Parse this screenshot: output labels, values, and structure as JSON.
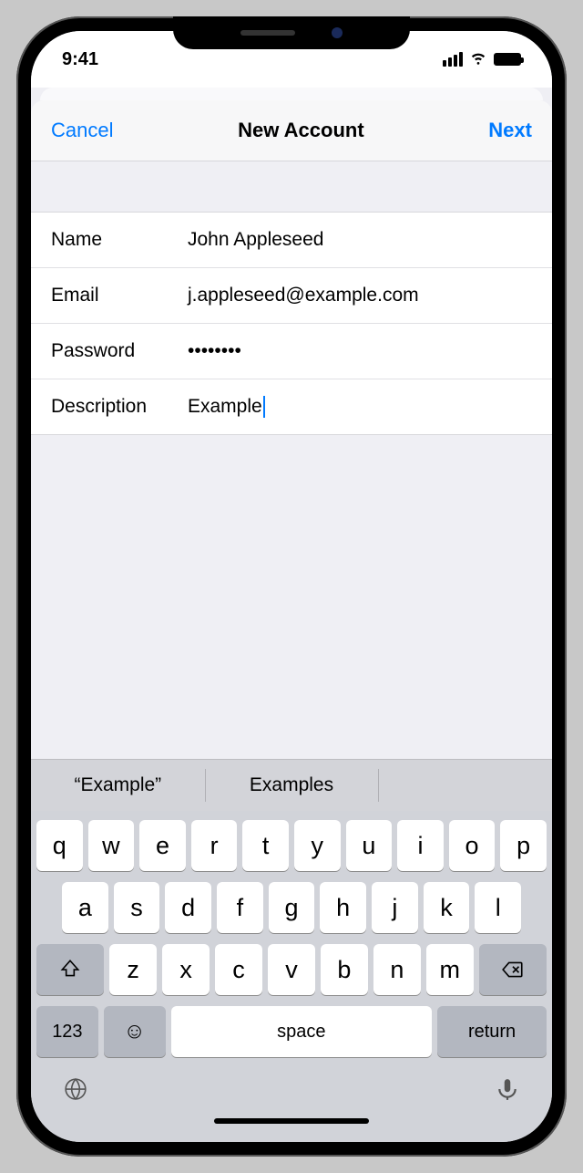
{
  "statusbar": {
    "time": "9:41"
  },
  "nav": {
    "cancel": "Cancel",
    "title": "New Account",
    "next": "Next"
  },
  "fields": {
    "name": {
      "label": "Name",
      "value": "John Appleseed"
    },
    "email": {
      "label": "Email",
      "value": "j.appleseed@example.com"
    },
    "password": {
      "label": "Password",
      "value": "••••••••"
    },
    "description": {
      "label": "Description",
      "value": "Example"
    }
  },
  "suggestions": [
    "“Example”",
    "Examples",
    ""
  ],
  "keyboard": {
    "row1": [
      "q",
      "w",
      "e",
      "r",
      "t",
      "y",
      "u",
      "i",
      "o",
      "p"
    ],
    "row2": [
      "a",
      "s",
      "d",
      "f",
      "g",
      "h",
      "j",
      "k",
      "l"
    ],
    "row3": [
      "z",
      "x",
      "c",
      "v",
      "b",
      "n",
      "m"
    ],
    "num": "123",
    "space": "space",
    "return": "return"
  }
}
